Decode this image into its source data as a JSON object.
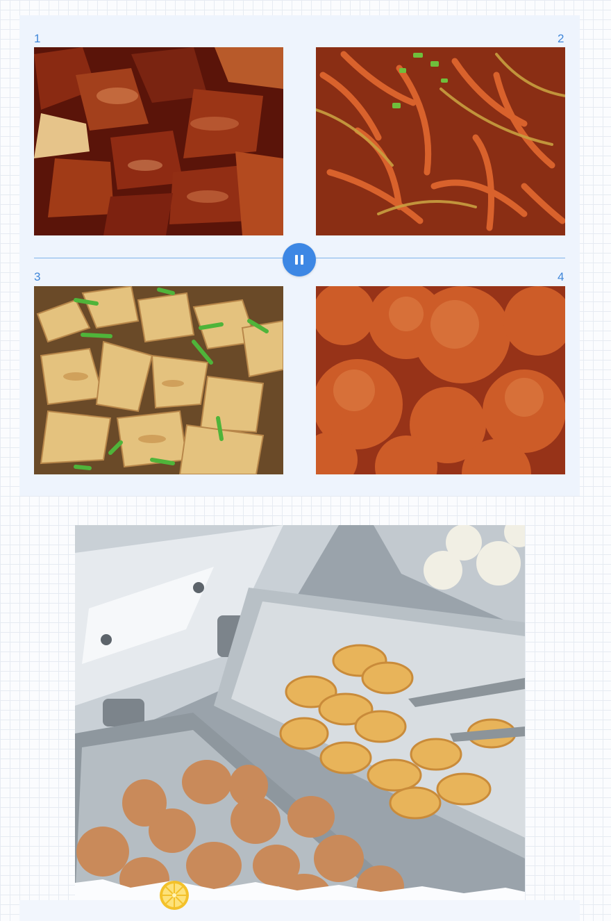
{
  "gallery": {
    "items": [
      {
        "number": "1",
        "dish": "braised-pork"
      },
      {
        "number": "2",
        "dish": "shredded-pork-stir-fry"
      },
      {
        "number": "3",
        "dish": "fried-potato-wedges"
      },
      {
        "number": "4",
        "dish": "fried-balls"
      }
    ],
    "control": {
      "icon": "pause-icon",
      "state": "playing"
    }
  },
  "feature": {
    "subject": "buffet-trays-eggs-pancakes-buns"
  },
  "decor": {
    "icon": "lemon-slice-icon"
  },
  "colors": {
    "accent": "#3d87e4",
    "panel": "#eef4fd",
    "number": "#3f86d9"
  }
}
